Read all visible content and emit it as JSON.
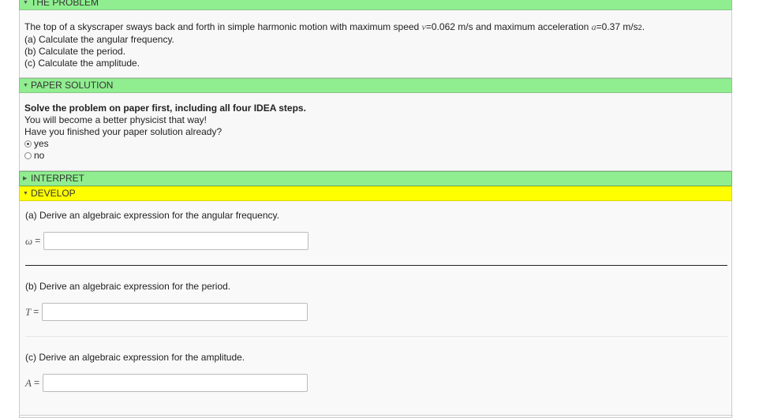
{
  "problem": {
    "header": "THE PROBLEM",
    "text_pre": "The top of a skyscraper sways back and forth in simple harmonic motion with maximum speed ",
    "v_sym": "v",
    "text_mid": "=0.062 m/s and maximum acceleration ",
    "a_sym": "a",
    "text_post": "=0.37 m/s",
    "text_sup": "2",
    "text_end": ".",
    "parts": [
      "(a) Calculate the angular frequency.",
      "(b) Calculate the period.",
      "(c) Calculate the amplitude."
    ]
  },
  "paper": {
    "header": "PAPER SOLUTION",
    "instruction": "Solve the problem on paper first, including all four IDEA steps.",
    "line2": "You will become a better physicist that way!",
    "question": "Have you finished your paper solution already?",
    "options": [
      {
        "label": "yes",
        "selected": true
      },
      {
        "label": "no",
        "selected": false
      }
    ]
  },
  "interpret": {
    "header": "INTERPRET"
  },
  "develop": {
    "header": "DEVELOP",
    "a": {
      "question": "(a) Derive an algebraic expression for the angular frequency.",
      "symbol": "ω",
      "eq": "=",
      "value": ""
    },
    "b": {
      "question": "(b) Derive an algebraic expression for the period.",
      "symbol": "T",
      "eq": "=",
      "value": ""
    },
    "c": {
      "question": "(c) Derive an algebraic expression for the amplitude.",
      "symbol": "A",
      "eq": "=",
      "value": ""
    }
  },
  "colors": {
    "green_header": "#90ee90",
    "yellow_header": "#ffff00"
  }
}
